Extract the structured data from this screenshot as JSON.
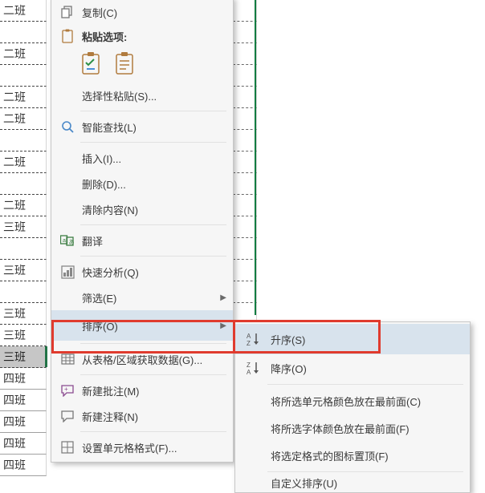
{
  "gridCells": [
    {
      "text": "二班",
      "classes": ""
    },
    {
      "text": "",
      "classes": ""
    },
    {
      "text": "二班",
      "classes": ""
    },
    {
      "text": "",
      "classes": ""
    },
    {
      "text": "二班",
      "classes": ""
    },
    {
      "text": "二班",
      "classes": ""
    },
    {
      "text": "",
      "classes": ""
    },
    {
      "text": "二班",
      "classes": ""
    },
    {
      "text": "",
      "classes": ""
    },
    {
      "text": "二班",
      "classes": ""
    },
    {
      "text": "三班",
      "classes": ""
    },
    {
      "text": "",
      "classes": ""
    },
    {
      "text": "三班",
      "classes": ""
    },
    {
      "text": "",
      "classes": ""
    },
    {
      "text": "三班",
      "classes": ""
    },
    {
      "text": "三班",
      "classes": ""
    },
    {
      "text": "三班",
      "classes": "selected"
    },
    {
      "text": "四班",
      "classes": "solid-bottom"
    },
    {
      "text": "四班",
      "classes": "solid-bottom"
    },
    {
      "text": "四班",
      "classes": "solid-bottom"
    },
    {
      "text": "四班",
      "classes": "solid-bottom"
    },
    {
      "text": "四班",
      "classes": "solid-bottom"
    }
  ],
  "menu": {
    "copy": "复制(C)",
    "pasteOptionsTitle": "粘贴选项:",
    "pasteSpecial": "选择性粘贴(S)...",
    "smartLookup": "智能查找(L)",
    "insert": "插入(I)...",
    "delete": "删除(D)...",
    "clear": "清除内容(N)",
    "translate": "翻译",
    "quickAnalysis": "快速分析(Q)",
    "filter": "筛选(E)",
    "sort": "排序(O)",
    "fromTable": "从表格/区域获取数据(G)...",
    "newComment": "新建批注(M)",
    "newNote": "新建注释(N)",
    "formatCells": "设置单元格格式(F)..."
  },
  "submenu": {
    "asc": "升序(S)",
    "desc": "降序(O)",
    "cellColor": "将所选单元格颜色放在最前面(C)",
    "fontColor": "将所选字体颜色放在最前面(F)",
    "iconTop": "将选定格式的图标置顶(F)",
    "custom": "自定义排序(U)"
  }
}
